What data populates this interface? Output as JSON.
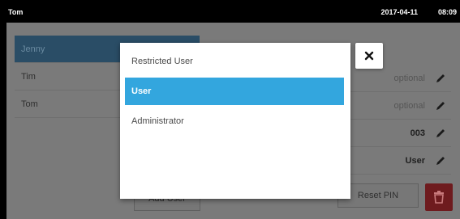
{
  "status_bar": {
    "user": "Tom",
    "date": "2017-04-11",
    "time": "08:09"
  },
  "user_list": {
    "items": [
      {
        "label": "Jenny",
        "selected": true
      },
      {
        "label": "Tim",
        "selected": false
      },
      {
        "label": "Tom",
        "selected": false
      }
    ]
  },
  "user_fields": {
    "rows": [
      {
        "value": "optional",
        "icon": "pencil-icon"
      },
      {
        "value": "optional",
        "icon": "pencil-icon"
      },
      {
        "value": "003",
        "icon": "pencil-icon"
      },
      {
        "value": "User",
        "icon": "pencil-icon"
      }
    ]
  },
  "bottom_buttons": {
    "add_user": "Add User",
    "reset_pin": "Reset PIN",
    "delete_icon": "trash-icon"
  },
  "role_dialog": {
    "options": [
      {
        "label": "Restricted User",
        "selected": false
      },
      {
        "label": "User",
        "selected": true
      },
      {
        "label": "Administrator",
        "selected": false
      }
    ],
    "close_icon": "close-icon"
  },
  "colors": {
    "selected_option": "#33a6de",
    "selected_list_item": "#2a4d66",
    "delete_button": "#6e1b1e",
    "overlay_background": "#7a7a7a"
  }
}
